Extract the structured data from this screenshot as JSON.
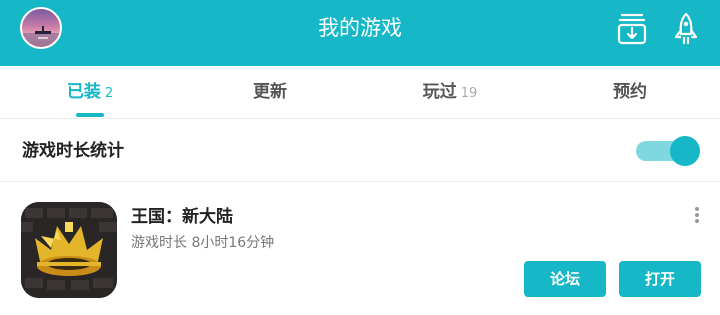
{
  "header": {
    "title": "我的游戏",
    "avatar": "user-avatar",
    "icons": [
      "download-manager-icon",
      "rocket-icon"
    ],
    "colors": {
      "brand": "#16b7c6"
    }
  },
  "tabs": [
    {
      "label": "已装",
      "count": "2",
      "active": true
    },
    {
      "label": "更新",
      "count": ""
    },
    {
      "label": "玩过",
      "count": "19"
    },
    {
      "label": "预约",
      "count": ""
    }
  ],
  "stats": {
    "label": "游戏时长统计",
    "enabled": true
  },
  "games": [
    {
      "name": "王国：新大陆",
      "playtime": "游戏时长 8小时16分钟",
      "icon": "kingdom-crown-icon",
      "buttons": {
        "forum": "论坛",
        "open": "打开"
      }
    }
  ]
}
